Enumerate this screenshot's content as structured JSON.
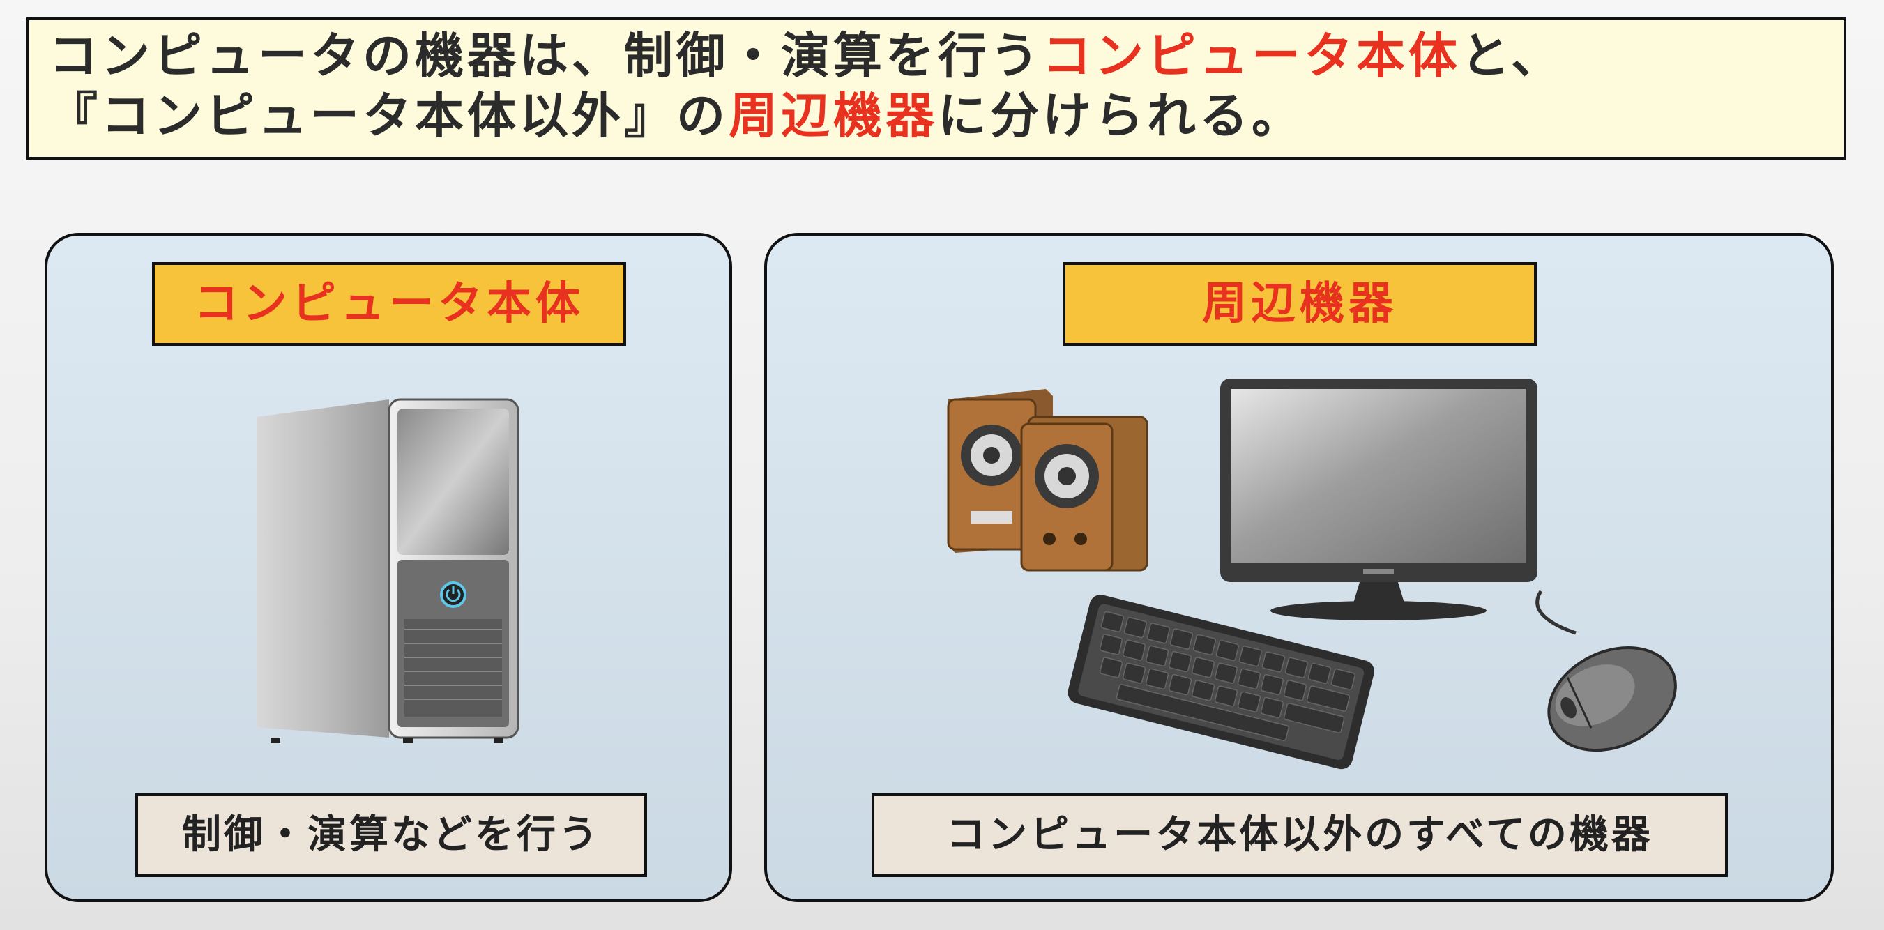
{
  "banner": {
    "line1_part1": "コンピュータの機器は、制御・演算を行う",
    "line1_highlight": "コンピュータ本体",
    "line1_part2": "と、",
    "line2_part1": "『コンピュータ本体以外』の",
    "line2_highlight": "周辺機器",
    "line2_part2": "に分けられる。"
  },
  "left_panel": {
    "title": "コンピュータ本体",
    "caption": "制御・演算などを行う",
    "illustration": "pc-tower-icon"
  },
  "right_panel": {
    "title": "周辺機器",
    "caption": "コンピュータ本体以外のすべての機器",
    "illustrations": [
      "speakers-icon",
      "monitor-icon",
      "keyboard-icon",
      "mouse-icon"
    ]
  },
  "colors": {
    "highlight": "#e8321f",
    "banner_bg": "#fdfbdc",
    "title_bg": "#f7c33b",
    "caption_bg": "#ece3d9",
    "panel_bg": "#d6e3ed"
  }
}
